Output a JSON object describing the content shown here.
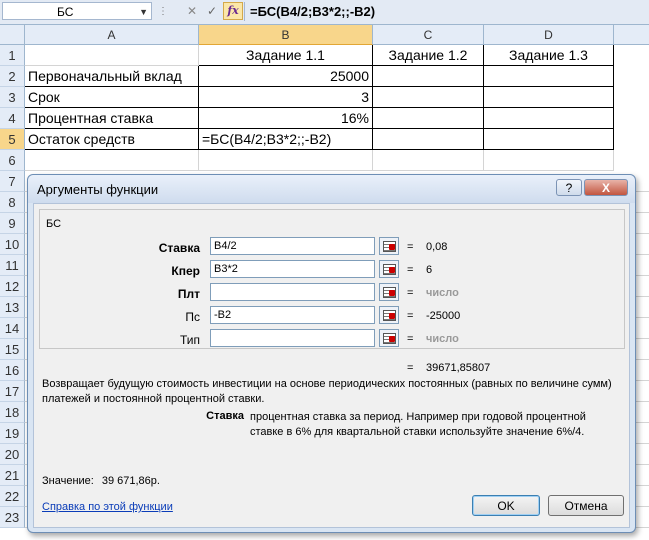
{
  "formula_bar": {
    "name_box": "БС",
    "fx_label": "fx",
    "formula": "=БС(B4/2;B3*2;;-B2)"
  },
  "columns": [
    "A",
    "B",
    "C",
    "D"
  ],
  "rows": [
    "1",
    "2",
    "3",
    "4",
    "5",
    "6",
    "7",
    "8",
    "9",
    "10",
    "11",
    "12",
    "13",
    "14",
    "15",
    "16",
    "17",
    "18",
    "19",
    "20",
    "21",
    "22",
    "23"
  ],
  "sheet": {
    "b1": "Задание 1.1",
    "c1": "Задание 1.2",
    "d1": "Задание 1.3",
    "a2": "Первоначальный вклад",
    "b2": "25000",
    "a3": "Срок",
    "b3": "3",
    "a4": "Процентная ставка",
    "b4": "16%",
    "a5": "Остаток средств",
    "b5": "=БС(B4/2;B3*2;;-B2)"
  },
  "dialog": {
    "title": "Аргументы функции",
    "help_button": "?",
    "close_button": "X",
    "function_name": "БС",
    "args": [
      {
        "label": "Ставка",
        "input": "B4/2",
        "result": "0,08"
      },
      {
        "label": "Кпер",
        "input": "B3*2",
        "result": "6"
      },
      {
        "label": "Плт",
        "input": "",
        "result": "число"
      },
      {
        "label": "Пс",
        "input": "-B2",
        "result": "-25000"
      },
      {
        "label": "Тип",
        "input": "",
        "result": "число"
      }
    ],
    "equals": "=",
    "formula_result": "39671,85807",
    "description": "Возвращает будущую стоимость инвестиции на основе периодических постоянных (равных по величине сумм) платежей и постоянной процентной ставки.",
    "arg_help_name": "Ставка",
    "arg_help_text": "процентная ставка за период. Например при годовой процентной ставке в 6% для квартальной ставки используйте значение 6%/4.",
    "value_label": "Значение:",
    "value": "39 671,86р.",
    "help_link": "Справка по этой функции",
    "ok": "OK",
    "cancel": "Отмена"
  }
}
